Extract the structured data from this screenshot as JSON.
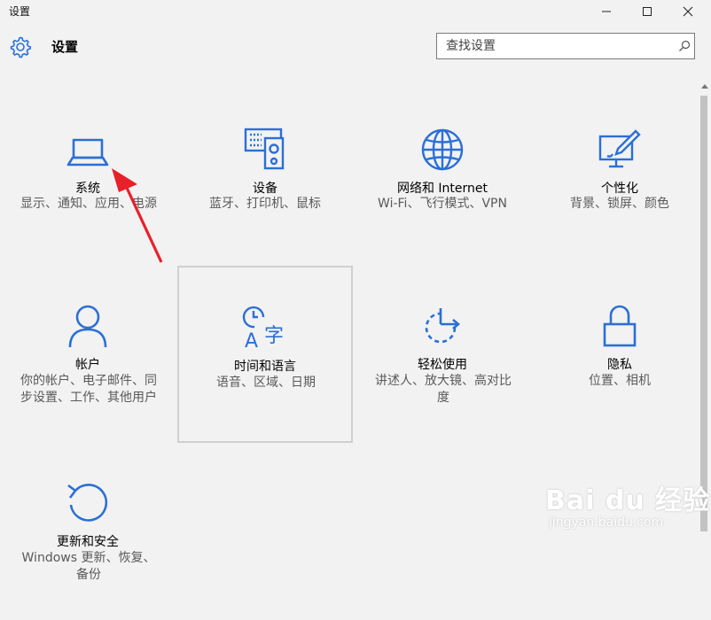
{
  "window": {
    "title": "设置",
    "minimize_icon": "minimize-icon",
    "maximize_icon": "maximize-icon",
    "close_icon": "close-icon"
  },
  "header": {
    "app_title": "设置",
    "app_icon": "gear-icon",
    "search_placeholder": "查找设置",
    "search_icon": "search-icon"
  },
  "accent_color": "#2b6fd6",
  "tiles": [
    {
      "name": "系统",
      "desc": "显示、通知、应用、电源",
      "icon": "laptop-icon"
    },
    {
      "name": "设备",
      "desc": "蓝牙、打印机、鼠标",
      "icon": "devices-icon"
    },
    {
      "name": "网络和 Internet",
      "desc": "Wi-Fi、飞行模式、VPN",
      "icon": "globe-icon"
    },
    {
      "name": "个性化",
      "desc": "背景、锁屏、颜色",
      "icon": "paint-icon"
    },
    {
      "name": "帐户",
      "desc": "你的帐户、电子邮件、同步设置、工作、其他用户",
      "icon": "person-icon"
    },
    {
      "name": "时间和语言",
      "desc": "语音、区域、日期",
      "icon": "time-language-icon"
    },
    {
      "name": "轻松使用",
      "desc": "讲述人、放大镜、高对比度",
      "icon": "ease-of-access-icon"
    },
    {
      "name": "隐私",
      "desc": "位置、相机",
      "icon": "lock-icon"
    },
    {
      "name": "更新和安全",
      "desc": "Windows 更新、恢复、备份",
      "icon": "refresh-icon"
    }
  ],
  "annotation": {
    "arrow_color": "#e8202a"
  },
  "watermark": {
    "brand": "Bai du 经验",
    "url": "jingyan.baidu.com"
  }
}
